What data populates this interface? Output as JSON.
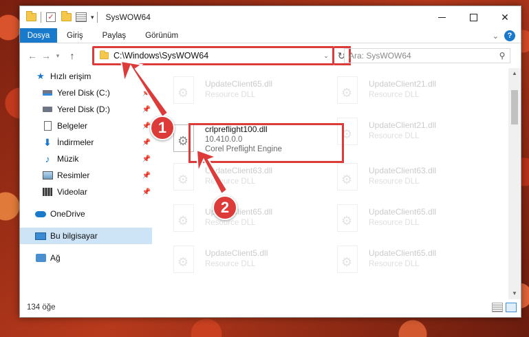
{
  "window": {
    "title": "SysWOW64",
    "controls": {
      "minimize": "—",
      "maximize": "",
      "close": "✕"
    }
  },
  "ribbon": {
    "tabs": [
      "Dosya",
      "Giriş",
      "Paylaş",
      "Görünüm"
    ],
    "help": "?"
  },
  "nav": {
    "back": "←",
    "forward": "→",
    "recent": "▾",
    "up": "↑",
    "address": "C:\\Windows\\SysWOW64",
    "refresh": "↻",
    "search_placeholder": "Ara: SysWOW64"
  },
  "sidebar": {
    "quick_access": "Hızlı erişim",
    "items": [
      {
        "label": "Yerel Disk (C:)",
        "icon": "drive-c-icon"
      },
      {
        "label": "Yerel Disk (D:)",
        "icon": "drive-d-icon"
      },
      {
        "label": "Belgeler",
        "icon": "documents-icon"
      },
      {
        "label": "İndirmeler",
        "icon": "downloads-icon"
      },
      {
        "label": "Müzik",
        "icon": "music-icon"
      },
      {
        "label": "Resimler",
        "icon": "pictures-icon"
      },
      {
        "label": "Videolar",
        "icon": "videos-icon"
      }
    ],
    "onedrive": "OneDrive",
    "this_pc": "Bu bilgisayar",
    "network": "Ağ"
  },
  "files": {
    "left": [
      {
        "name": "UpdateClient65.dll",
        "sub": "Resource DLL"
      },
      {
        "name": "crlpreflight100.dll",
        "sub": "10.410.0.0",
        "desc": "Corel Preflight Engine"
      },
      {
        "name": "UpdateClient63.dll",
        "sub": "Resource DLL"
      },
      {
        "name": "UpdateClient65.dll",
        "sub": "Resource DLL"
      },
      {
        "name": "UpdateClient5.dll",
        "sub": "Resource DLL"
      }
    ],
    "right": [
      {
        "name": "UpdateClient21.dll",
        "sub": "Resource DLL"
      },
      {
        "name": "UpdateClient21.dll",
        "sub": "Resource DLL"
      },
      {
        "name": "UpdateClient63.dll",
        "sub": "Resource DLL"
      },
      {
        "name": "UpdateClient65.dll",
        "sub": "Resource DLL"
      },
      {
        "name": "UpdateClient65.dll",
        "sub": "Resource DLL"
      }
    ]
  },
  "status": {
    "count": "134 öğe"
  },
  "callouts": {
    "one": "1",
    "two": "2"
  },
  "colors": {
    "accent": "#1979ca",
    "annotation": "#dd3a3a"
  }
}
